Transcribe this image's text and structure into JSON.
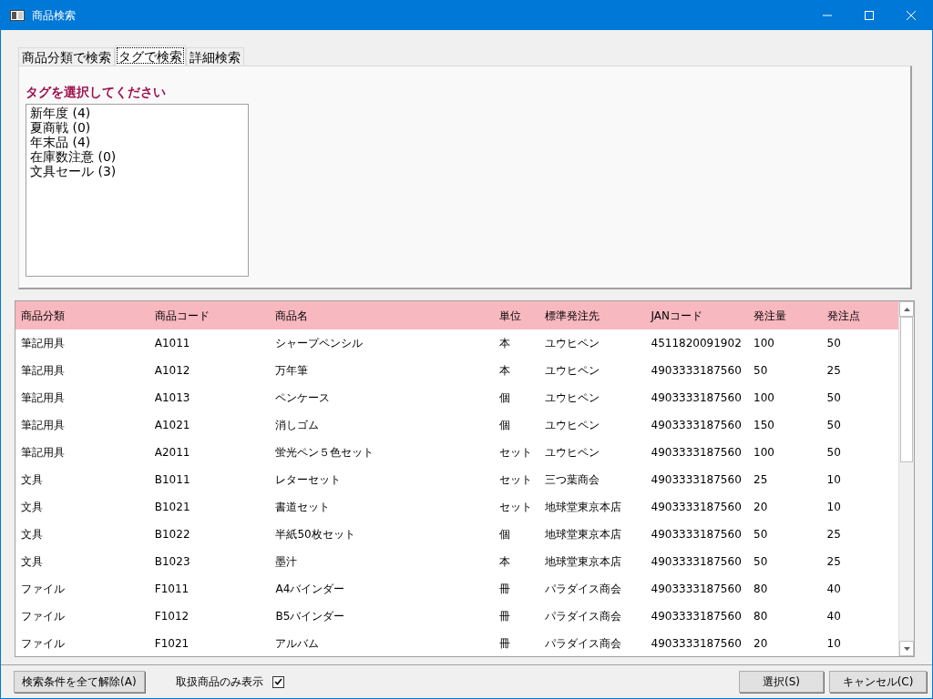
{
  "window": {
    "title": "商品検索"
  },
  "tabs": [
    {
      "label": "商品分類で検索",
      "selected": false
    },
    {
      "label": "タグで検索",
      "selected": true
    },
    {
      "label": "詳細検索",
      "selected": false
    }
  ],
  "tag_panel": {
    "heading": "タグを選択してください",
    "items": [
      "新年度 (4)",
      "夏商戦 (0)",
      "年末品 (4)",
      "在庫数注意 (0)",
      "文具セール (3)"
    ]
  },
  "table": {
    "columns": [
      "商品分類",
      "商品コード",
      "商品名",
      "単位",
      "標準発注先",
      "JANコード",
      "発注量",
      "発注点"
    ],
    "rows": [
      [
        "筆記用具",
        "A1011",
        "シャープペンシル",
        "本",
        "ユウヒペン",
        "4511820091902",
        "100",
        "50"
      ],
      [
        "筆記用具",
        "A1012",
        "万年筆",
        "本",
        "ユウヒペン",
        "4903333187560",
        "50",
        "25"
      ],
      [
        "筆記用具",
        "A1013",
        "ペンケース",
        "個",
        "ユウヒペン",
        "4903333187560",
        "100",
        "50"
      ],
      [
        "筆記用具",
        "A1021",
        "消しゴム",
        "個",
        "ユウヒペン",
        "4903333187560",
        "150",
        "50"
      ],
      [
        "筆記用具",
        "A2011",
        "蛍光ペン５色セット",
        "セット",
        "ユウヒペン",
        "4903333187560",
        "100",
        "50"
      ],
      [
        "文具",
        "B1011",
        "レターセット",
        "セット",
        "三つ葉商会",
        "4903333187560",
        "25",
        "10"
      ],
      [
        "文具",
        "B1021",
        "書道セット",
        "セット",
        "地球堂東京本店",
        "4903333187560",
        "20",
        "10"
      ],
      [
        "文具",
        "B1022",
        "半紙50枚セット",
        "個",
        "地球堂東京本店",
        "4903333187560",
        "50",
        "25"
      ],
      [
        "文具",
        "B1023",
        "墨汁",
        "本",
        "地球堂東京本店",
        "4903333187560",
        "50",
        "25"
      ],
      [
        "ファイル",
        "F1011",
        "A4バインダー",
        "冊",
        "パラダイス商会",
        "4903333187560",
        "80",
        "40"
      ],
      [
        "ファイル",
        "F1012",
        "B5バインダー",
        "冊",
        "パラダイス商会",
        "4903333187560",
        "80",
        "40"
      ],
      [
        "ファイル",
        "F1021",
        "アルバム",
        "冊",
        "パラダイス商会",
        "4903333187560",
        "20",
        "10"
      ]
    ]
  },
  "footer": {
    "clear_button": "検索条件を全て解除(A)",
    "filter": {
      "label": "取扱商品のみ表示",
      "checked": true
    },
    "buttons": [
      "選択(S)",
      "キャンセル(C)"
    ]
  }
}
